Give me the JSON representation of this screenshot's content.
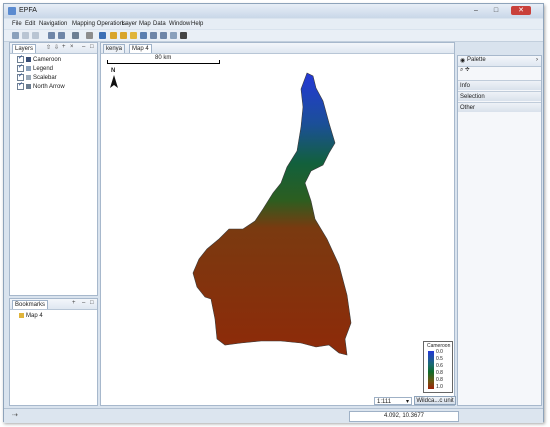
{
  "window": {
    "title": "EPFA",
    "controls": [
      "–",
      "□",
      "✕"
    ]
  },
  "menu": [
    "File",
    "Edit",
    "Navigation",
    "Mapping Operations",
    "Layer",
    "Map",
    "Data",
    "Window",
    "Help"
  ],
  "layers_view": {
    "tab_label": "Layers",
    "items": [
      {
        "label": "Cameroon",
        "icon": "map-layer-icon"
      },
      {
        "label": "Legend",
        "icon": "legend-icon"
      },
      {
        "label": "Scalebar",
        "icon": "scalebar-icon"
      },
      {
        "label": "North Arrow",
        "icon": "north-arrow-icon"
      }
    ]
  },
  "bookmarks_view": {
    "tab_label": "Bookmarks",
    "items": [
      {
        "label": "Map 4"
      }
    ]
  },
  "editor_tabs": [
    {
      "label": "kenya"
    },
    {
      "label": "Map 4"
    }
  ],
  "map": {
    "scalebar_label": "80 km",
    "north_label": "N",
    "legend": {
      "title": "Cameroon",
      "ticks": [
        "0.0",
        "0.5",
        "0.6",
        "0.8",
        "0.8",
        "1.0"
      ]
    },
    "colors": {
      "low": "#2438d6",
      "mid": "#0f6b2a",
      "high": "#9e2008"
    }
  },
  "palette": {
    "title": "Palette",
    "sections": [
      "Info",
      "Selection",
      "Other"
    ]
  },
  "map_footer": {
    "scale_value": "1:111",
    "crs_button": "Wildca...c unit"
  },
  "status": {
    "coordinates": "4.092, 10.3677"
  }
}
